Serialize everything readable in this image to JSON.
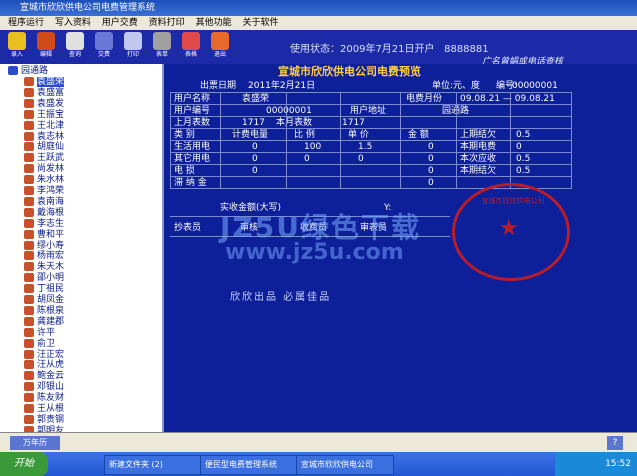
{
  "window": {
    "title": "宣城市欣欣供电公司电费管理系统"
  },
  "menu": [
    "程序运行",
    "写入资料",
    "用户交费",
    "资料打印",
    "其他功能",
    "关于软件"
  ],
  "toolbar": [
    {
      "label": "录入",
      "icon": "pin-icon",
      "color": "#e8c020"
    },
    {
      "label": "编辑",
      "icon": "clipboard-icon",
      "color": "#d04a1a"
    },
    {
      "label": "查询",
      "icon": "search-icon",
      "color": "#e0e0e0"
    },
    {
      "label": "交费",
      "icon": "calculator-icon",
      "color": "#6a78d8"
    },
    {
      "label": "打印",
      "icon": "printer-icon",
      "color": "#c0c8f0"
    },
    {
      "label": "表单",
      "icon": "form-icon",
      "color": "#a0a0a0"
    },
    {
      "label": "表格",
      "icon": "pen-icon",
      "color": "#e04a4a"
    },
    {
      "label": "退出",
      "icon": "power-icon",
      "color": "#e86a2a"
    }
  ],
  "status": {
    "text": "使用状态：2009年7月21日开户",
    "id": "8888881"
  },
  "hint": "广名曾娟或电话查核",
  "tree": {
    "root": "园通路",
    "items": [
      "袁盛荣",
      "袁盛富",
      "袁盛发",
      "王振宝",
      "王北津",
      "袁志林",
      "胡庭仙",
      "王跃武",
      "尚发林",
      "朱水林",
      "李鸿荣",
      "袁南海",
      "戴海根",
      "李志生",
      "曹和平",
      "缪小寿",
      "杨雨宏",
      "朱天木",
      "邵小明",
      "丁祖民",
      "胡凤金",
      "陈根泉",
      "龚建郡",
      "许平",
      "俞卫",
      "汪正宏",
      "汪从虎",
      "鲍金云",
      "邓银山",
      "陈友财",
      "王从根",
      "郭贵钢",
      "郭明友"
    ]
  },
  "bill": {
    "company": "宣城市欣欣供电公司电费预览",
    "issue_date_label": "出票日期",
    "issue_date": "2011年2月21日",
    "unit_label": "单位:元、度",
    "no_label": "编号:",
    "no": "00000001",
    "user_name_label": "用户名称",
    "user_name": "袁盛荣",
    "month_label": "电费月份",
    "month": "09.08.21 — 09.08.21",
    "user_code_label": "用户编号",
    "user_code": "00000001",
    "address_label": "用户地址",
    "address": "园通路",
    "prev_reading_label": "上月表数",
    "prev_reading": "1717",
    "curr_reading_label": "本月表数",
    "curr_reading": "1717",
    "header": {
      "category": "类 别",
      "usage": "计费电量",
      "ratio": "比 例",
      "price": "单 价",
      "amount": "金 额",
      "prev_balance": "上期结欠",
      "prev_balance_val": "0.5"
    },
    "rows": [
      {
        "label": "生活用电",
        "usage": "0",
        "ratio": "100",
        "price": "1.5",
        "amount": "0",
        "side_label": "本期电费",
        "side_val": "0"
      },
      {
        "label": "其它用电",
        "usage": "0",
        "ratio": "0",
        "price": "0",
        "amount": "0",
        "side_label": "本次应收",
        "side_val": "0.5"
      },
      {
        "label": "电 损",
        "usage": "0",
        "ratio": "",
        "price": "",
        "amount": "0",
        "side_label": "本期结欠",
        "side_val": "0.5"
      },
      {
        "label": "滞 纳 金",
        "usage": "",
        "ratio": "",
        "price": "",
        "amount": "0",
        "side_label": "",
        "side_val": ""
      }
    ],
    "total_label": "实收金额(大写)",
    "total_symbol": "Y:",
    "reader_label": "抄表员",
    "cashier_label": "审核",
    "collector_label": "收费员",
    "auditor_label": "审表员",
    "seal_text": "宣城市欣欣供电公司",
    "footer": "欣欣出品 必属佳品"
  },
  "watermark": {
    "brand": "JZ5U绿色下载",
    "url": "www.jz5u.com"
  },
  "bottombar": {
    "left": "万年历",
    "right": "?"
  },
  "taskbar": {
    "start": "开始",
    "tasks": [
      "新建文件夹 (2)",
      "便民型电费管理系统",
      "宣城市欣欣供电公司"
    ],
    "clock": "15:52"
  }
}
